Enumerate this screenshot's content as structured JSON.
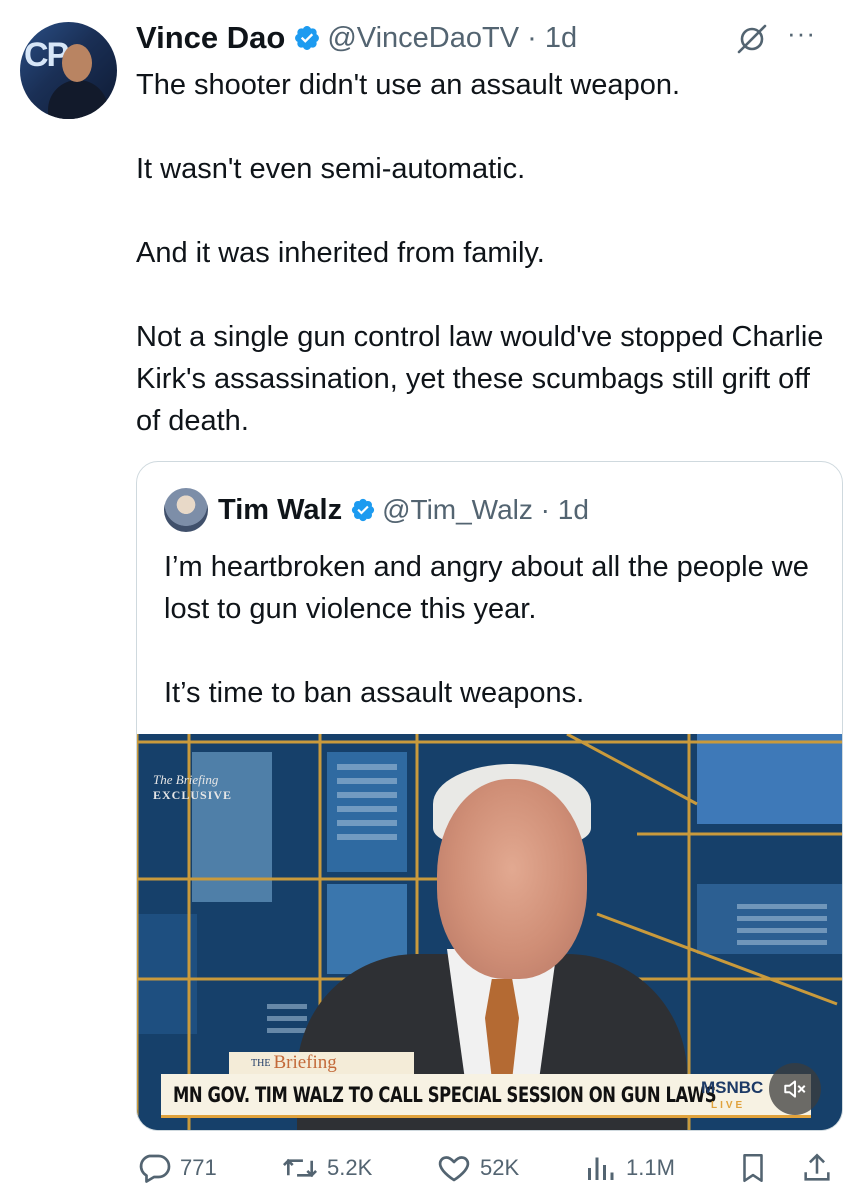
{
  "tweet": {
    "author_name": "Vince Dao",
    "handle_time": "@VinceDaoTV · 1d",
    "more_icon": "···",
    "paragraphs": [
      "The shooter didn't use an assault weapon.",
      "It wasn't even semi-automatic.",
      "And it was inherited from family.",
      "Not a single gun control law would've stopped Charlie Kirk's assassination, yet these scumbags still grift off of death."
    ]
  },
  "quote": {
    "author_name": "Tim Walz",
    "handle_time": "@Tim_Walz · 1d",
    "paragraphs": [
      "I’m heartbroken and angry about all the people we lost to gun violence this year.",
      "It’s time to ban assault weapons."
    ],
    "video": {
      "corner_tag_line1": "The Briefing",
      "corner_tag_line2": "EXCLUSIVE",
      "show_prefix": "THE",
      "show_name": "Briefing",
      "headline": "MN GOV. TIM WALZ TO CALL SPECIAL SESSION ON GUN LAWS",
      "network": "MSNBC",
      "live": "LIVE"
    }
  },
  "actions": {
    "replies": "771",
    "reposts": "5.2K",
    "likes": "52K",
    "views": "1.1M"
  },
  "colors": {
    "verified": "#1d9bf0",
    "secondary_text": "#536471",
    "border": "#cfd9de"
  }
}
